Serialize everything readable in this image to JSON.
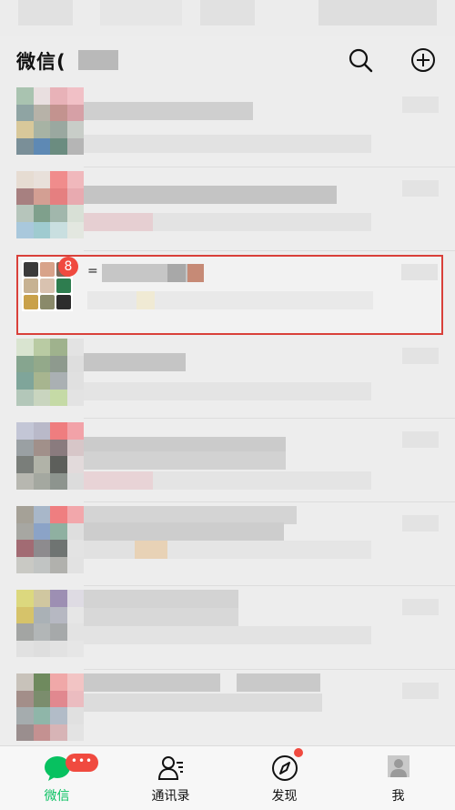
{
  "header": {
    "title": "微信("
  },
  "highlighted_chat": {
    "badge": "8",
    "name_fragment": "="
  },
  "tabs": [
    {
      "label": "微信",
      "icon": "chat-bubble-icon",
      "badge": "•••",
      "active": true
    },
    {
      "label": "通讯录",
      "icon": "contacts-icon",
      "active": false
    },
    {
      "label": "发现",
      "icon": "compass-icon",
      "active": false
    },
    {
      "label": "我",
      "icon": "profile-icon",
      "active": false
    }
  ],
  "colors": {
    "accent": "#07c160",
    "badge": "#f04a3f",
    "highlight_border": "#d9403a"
  }
}
